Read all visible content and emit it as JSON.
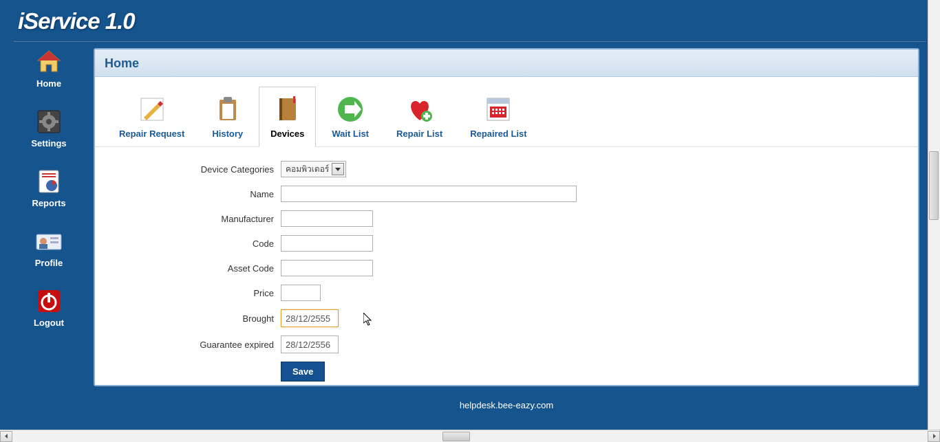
{
  "app": {
    "title": "iService 1.0"
  },
  "sidebar": {
    "items": [
      {
        "label": "Home"
      },
      {
        "label": "Settings"
      },
      {
        "label": "Reports"
      },
      {
        "label": "Profile"
      },
      {
        "label": "Logout"
      }
    ]
  },
  "panel": {
    "title": "Home"
  },
  "toolbar": {
    "items": [
      {
        "label": "Repair Request"
      },
      {
        "label": "History"
      },
      {
        "label": "Devices"
      },
      {
        "label": "Wait List"
      },
      {
        "label": "Repair List"
      },
      {
        "label": "Repaired List"
      }
    ],
    "active_index": 2
  },
  "form": {
    "labels": {
      "device_categories": "Device Categories",
      "name": "Name",
      "manufacturer": "Manufacturer",
      "code": "Code",
      "asset_code": "Asset Code",
      "price": "Price",
      "brought": "Brought",
      "guarantee_expired": "Guarantee expired"
    },
    "values": {
      "device_categories": "คอมพิวเตอร์",
      "name": "",
      "manufacturer": "",
      "code": "",
      "asset_code": "",
      "price": "",
      "brought": "28/12/2555",
      "guarantee_expired": "28/12/2556"
    },
    "save_label": "Save"
  },
  "footer": {
    "text": "helpdesk.bee-eazy.com"
  }
}
